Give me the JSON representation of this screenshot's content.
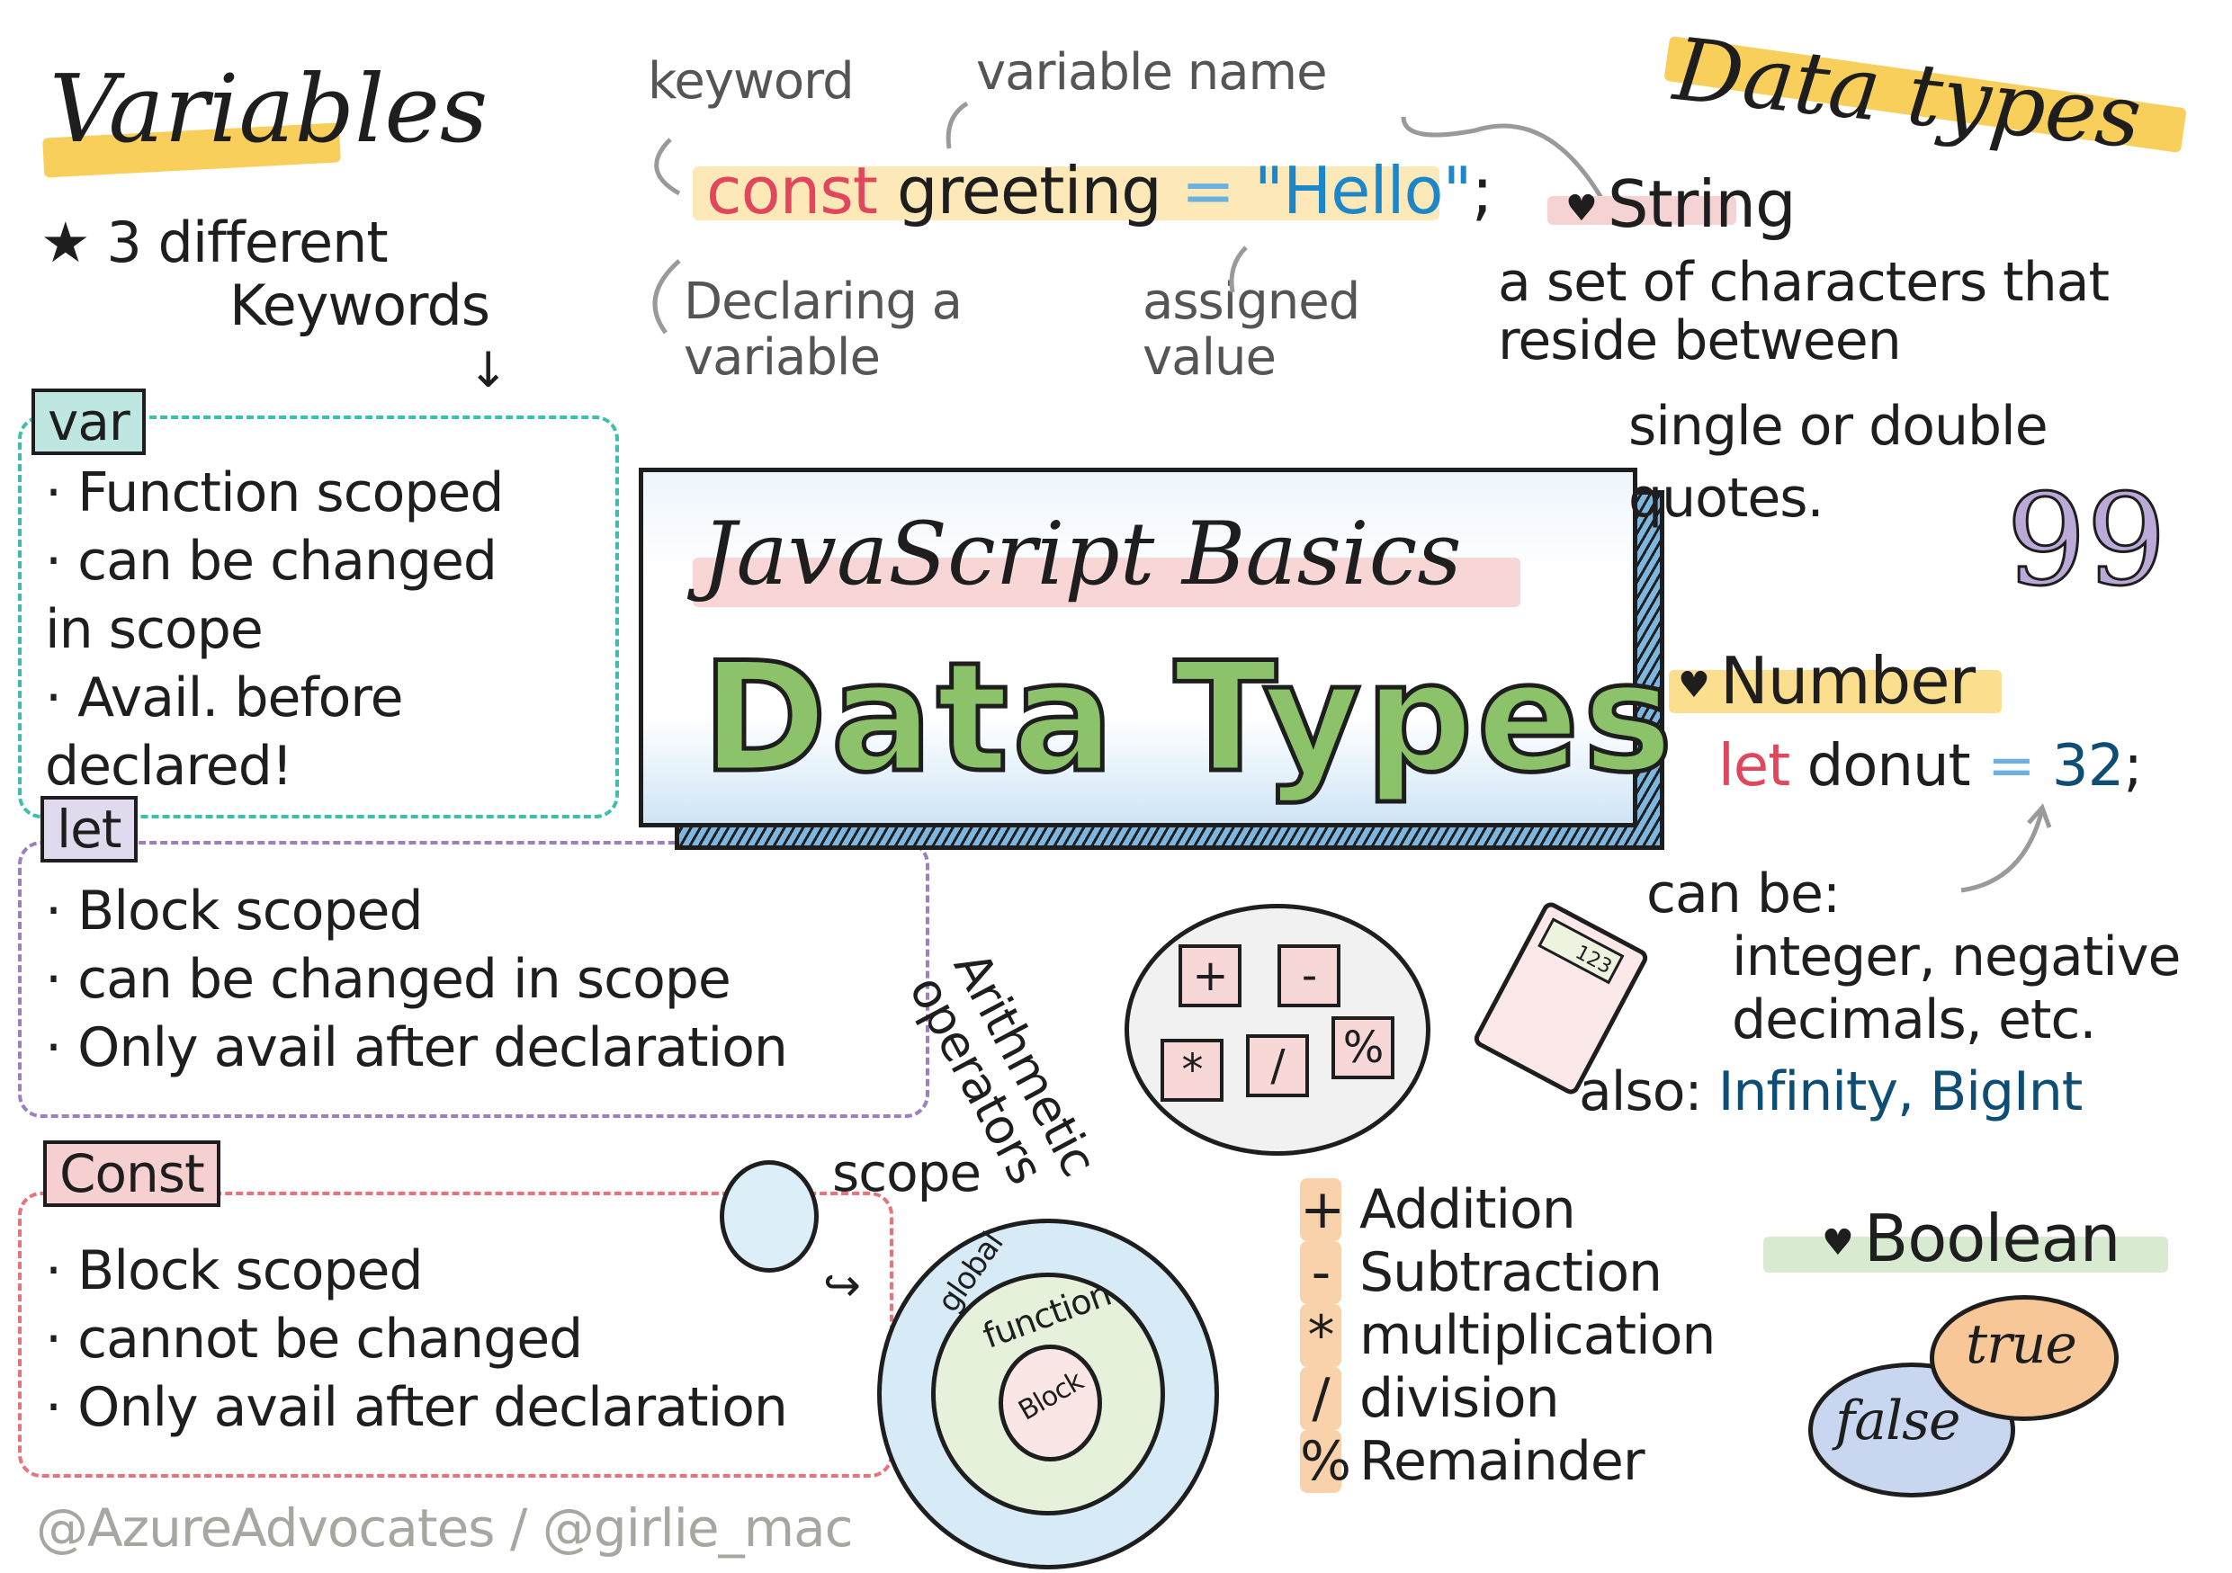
{
  "variables": {
    "title": "Variables",
    "intro_line1": "3 different",
    "intro_line2": "Keywords",
    "keywords": [
      {
        "name": "var",
        "color": "#3dbfad",
        "bullets": [
          "Function scoped",
          "can be changed in scope",
          "Avail. before declared!"
        ]
      },
      {
        "name": "let",
        "color": "#9b7fc0",
        "bullets": [
          "Block scoped",
          "can be changed in scope",
          "Only avail after declaration"
        ]
      },
      {
        "name": "Const",
        "color": "#e8737b",
        "bullets": [
          "Block scoped",
          "cannot be changed",
          "Only avail after declaration"
        ]
      }
    ]
  },
  "declaration_example": {
    "keyword": "const",
    "name": "greeting",
    "operator": "=",
    "value": "\"Hello\"",
    "terminator": ";",
    "annotations": {
      "keyword": "keyword",
      "variable_name": "variable name",
      "declaring": "Declaring a variable",
      "assigned": "assigned value"
    }
  },
  "center_title": {
    "subtitle": "JavaScript Basics",
    "title": "Data Types"
  },
  "data_types": {
    "title": "Data types",
    "string": {
      "heading": "String",
      "description_1": "a set of characters that",
      "description_2": "reside between",
      "description_3": "single or double",
      "description_4": "quotes.",
      "quote_glyph": "99"
    },
    "number": {
      "heading": "Number",
      "code_keyword": "let",
      "code_name": "donut",
      "code_operator": "=",
      "code_value": "32",
      "code_terminator": ";",
      "can_be_label": "can be:",
      "can_be_1": "integer, negative",
      "can_be_2": "decimals, etc.",
      "also_label": "also:",
      "also_values": "Infinity, BigInt"
    },
    "boolean": {
      "heading": "Boolean",
      "true_label": "true",
      "false_label": "false"
    }
  },
  "arithmetic": {
    "label_line1": "Arithmetic",
    "label_line2": "operators",
    "keys": [
      "+",
      "-",
      "*",
      "/",
      "%"
    ],
    "operators": [
      {
        "symbol": "+",
        "name": "Addition"
      },
      {
        "symbol": "-",
        "name": "Subtraction"
      },
      {
        "symbol": "*",
        "name": "multiplication"
      },
      {
        "symbol": "/",
        "name": "division"
      },
      {
        "symbol": "%",
        "name": "Remainder"
      }
    ],
    "calculator_display": "123"
  },
  "scope": {
    "label": "scope",
    "rings": [
      "global",
      "function",
      "Block"
    ]
  },
  "credit": "@AzureAdvocates / @girlie_mac",
  "colors": {
    "highlight_yellow": "#f8cf5a",
    "highlight_pink": "#f6d3d3",
    "highlight_green": "#cfe5c6",
    "keyword_red": "#e0475d",
    "value_blue": "#1c86c8",
    "number_blue": "#0e4d74"
  }
}
